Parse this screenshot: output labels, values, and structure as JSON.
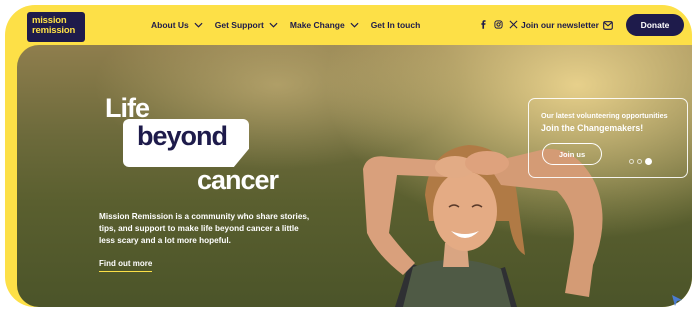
{
  "header": {
    "logo_line1": "mission",
    "logo_line2": "remission",
    "nav": [
      {
        "label": "About Us",
        "has_dropdown": true
      },
      {
        "label": "Get Support",
        "has_dropdown": true
      },
      {
        "label": "Make Change",
        "has_dropdown": true
      },
      {
        "label": "Get In touch",
        "has_dropdown": false
      }
    ],
    "social_icons": [
      "facebook-icon",
      "instagram-icon",
      "x-icon"
    ],
    "newsletter_label": "Join our newsletter",
    "donate_label": "Donate"
  },
  "hero": {
    "title_line1": "Life",
    "title_line2": "beyond",
    "title_line3": "cancer",
    "blurb": "Mission Remission is a community who share stories, tips, and support to make life beyond cancer a little less scary and a lot more hopeful.",
    "cta_label": "Find out more"
  },
  "card": {
    "subtitle": "Our latest volunteering opportunities",
    "title": "Join the Changemakers!",
    "button_label": "Join us",
    "slide_count": 3,
    "active_slide": 3
  },
  "colors": {
    "brand_yellow": "#fde047",
    "brand_navy": "#1e1b4b"
  }
}
